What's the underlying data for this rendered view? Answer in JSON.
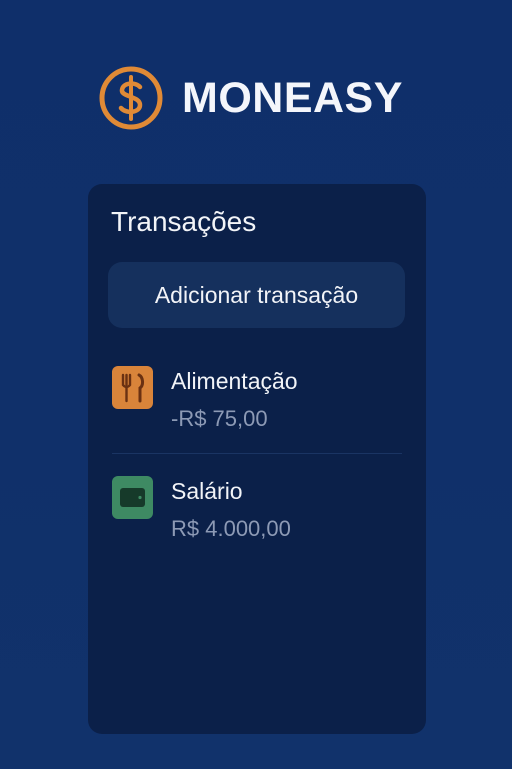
{
  "brand": {
    "name": "MONEASY",
    "icon": "dollar-coin-icon",
    "accent_color": "#e08a36"
  },
  "transactions_card": {
    "title": "Transações",
    "add_button_label": "Adicionar transação",
    "items": [
      {
        "name": "Alimentação",
        "amount": "-R$ 75,00",
        "icon": "fork-knife-icon",
        "icon_color": "#d9843a"
      },
      {
        "name": "Salário",
        "amount": "R$ 4.000,00",
        "icon": "wallet-icon",
        "icon_color": "#3e8a63"
      }
    ]
  }
}
